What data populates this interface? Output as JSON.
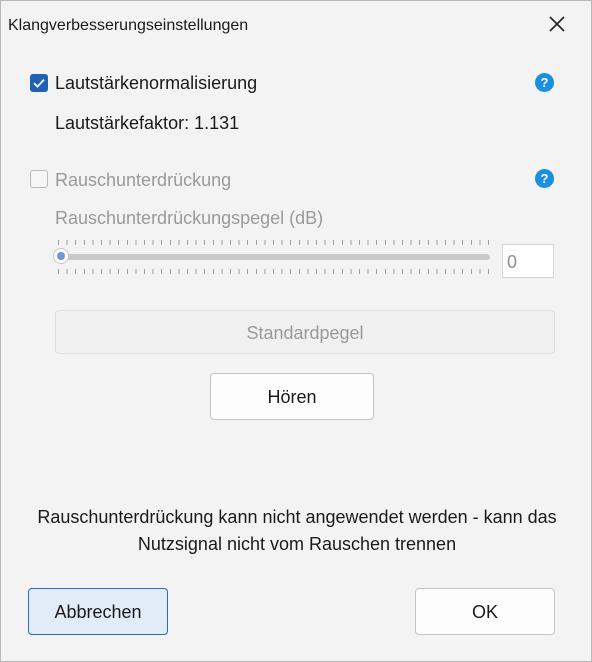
{
  "window": {
    "title": "Klangverbesserungseinstellungen"
  },
  "icons": {
    "close": "close-icon",
    "check": "checkmark-icon",
    "help": "help-icon"
  },
  "normalization": {
    "label": "Lautstärkenormalisierung",
    "checked": true,
    "factor_text": "Lautstärkefaktor: 1.131",
    "help_glyph": "?"
  },
  "noise_reduction": {
    "label": "Rauschunterdrückung",
    "checked": false,
    "help_glyph": "?",
    "level_label": "Rauschunterdrückungspegel (dB)",
    "slider_value": 0,
    "value_field": "0",
    "default_button": "Standardpegel"
  },
  "listen_button": "Hören",
  "message": "Rauschunterdrückung kann nicht angewendet werden - kann das Nutzsignal nicht vom Rauschen trennen",
  "buttons": {
    "cancel": "Abbrechen",
    "ok": "OK"
  },
  "colors": {
    "accent": "#2161b3",
    "help": "#1d8fe0",
    "cancel_bg": "#e1ecf9"
  }
}
